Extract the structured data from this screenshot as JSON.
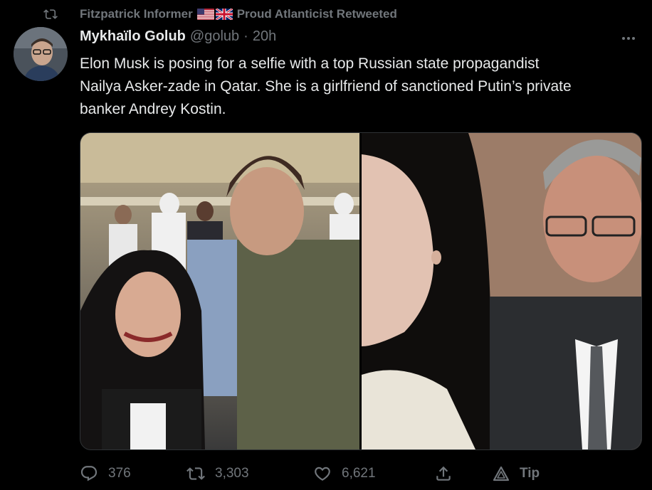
{
  "social_context": {
    "retweeter_name": "Fitzpatrick Informer",
    "flag_icons": [
      "us-flag-icon",
      "uk-flag-icon"
    ],
    "suffix": "Proud Atlanticist Retweeted"
  },
  "tweet": {
    "author_name": "Mykhaïlo Golub",
    "author_handle": "@golub",
    "separator": "·",
    "time": "20h",
    "text_lines": [
      "Elon Musk is posing for a selfie with a top Russian state propagandist",
      "Nailya Asker-zade in Qatar. She is a girlfriend of sanctioned Putin’s private",
      "banker Andrey Kostin."
    ],
    "media": [
      "photo-selfie",
      "photo-portraits"
    ]
  },
  "actions": {
    "reply_count": "376",
    "retweet_count": "3,303",
    "like_count": "6,621",
    "tip_label": "Tip"
  },
  "colors": {
    "background": "#000000",
    "text_primary": "#e7e9ea",
    "text_secondary": "#71767b"
  }
}
